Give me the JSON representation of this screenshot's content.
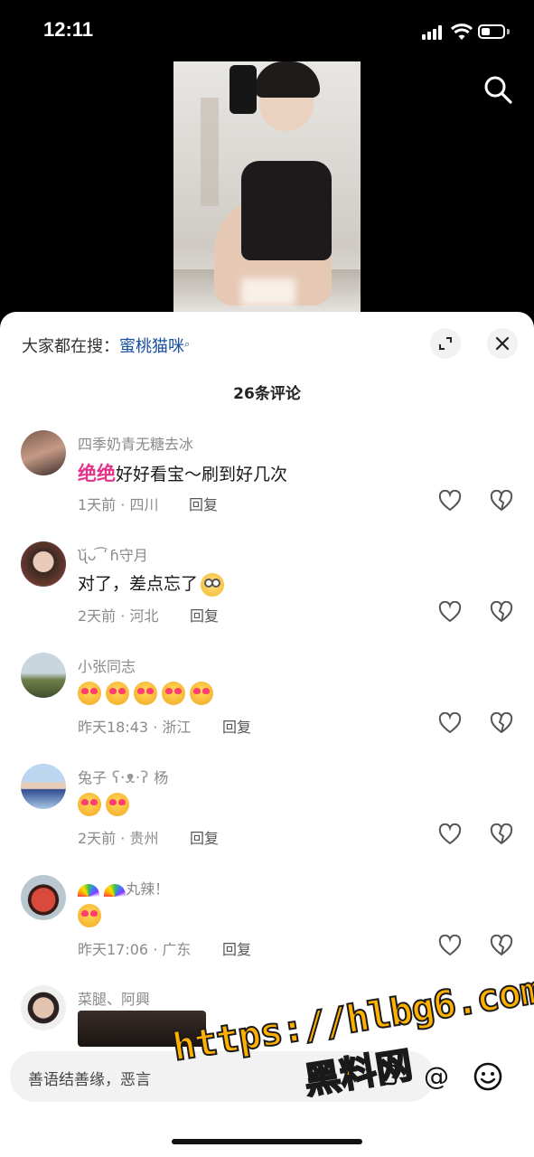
{
  "status_bar": {
    "time": "12:11"
  },
  "sheet": {
    "hot_search_prefix": "大家都在搜：",
    "hot_search_keyword": "蜜桃猫咪",
    "comment_count": "26条评论"
  },
  "comments": [
    {
      "name": "四季奶青无糖去冰",
      "highlight": "绝绝",
      "text": "好好看宝～刷到好几次",
      "meta": "1天前 · 四川",
      "reply": "回复"
    },
    {
      "name": "ʯ̆ᴗ ͡ ̕ ɦ守月",
      "text": "对了，差点忘了",
      "meta": "2天前 · 河北",
      "reply": "回复"
    },
    {
      "name": "小张同志",
      "emoji_count": 5,
      "meta": "昨天18:43 · 浙江",
      "reply": "回复"
    },
    {
      "name_prefix": "兔子",
      "name_suffix": "杨",
      "emoji_count": 2,
      "meta": "2天前 · 贵州",
      "reply": "回复"
    },
    {
      "name_suffix": "丸辣！",
      "meta": "昨天17:06 · 广东",
      "reply": "回复"
    },
    {
      "name": "菜腿、阿興"
    }
  ],
  "input": {
    "placeholder": "善语结善缘，恶言"
  },
  "watermark": {
    "line1": "https://hlbg6.com",
    "line2": "黑料网"
  }
}
